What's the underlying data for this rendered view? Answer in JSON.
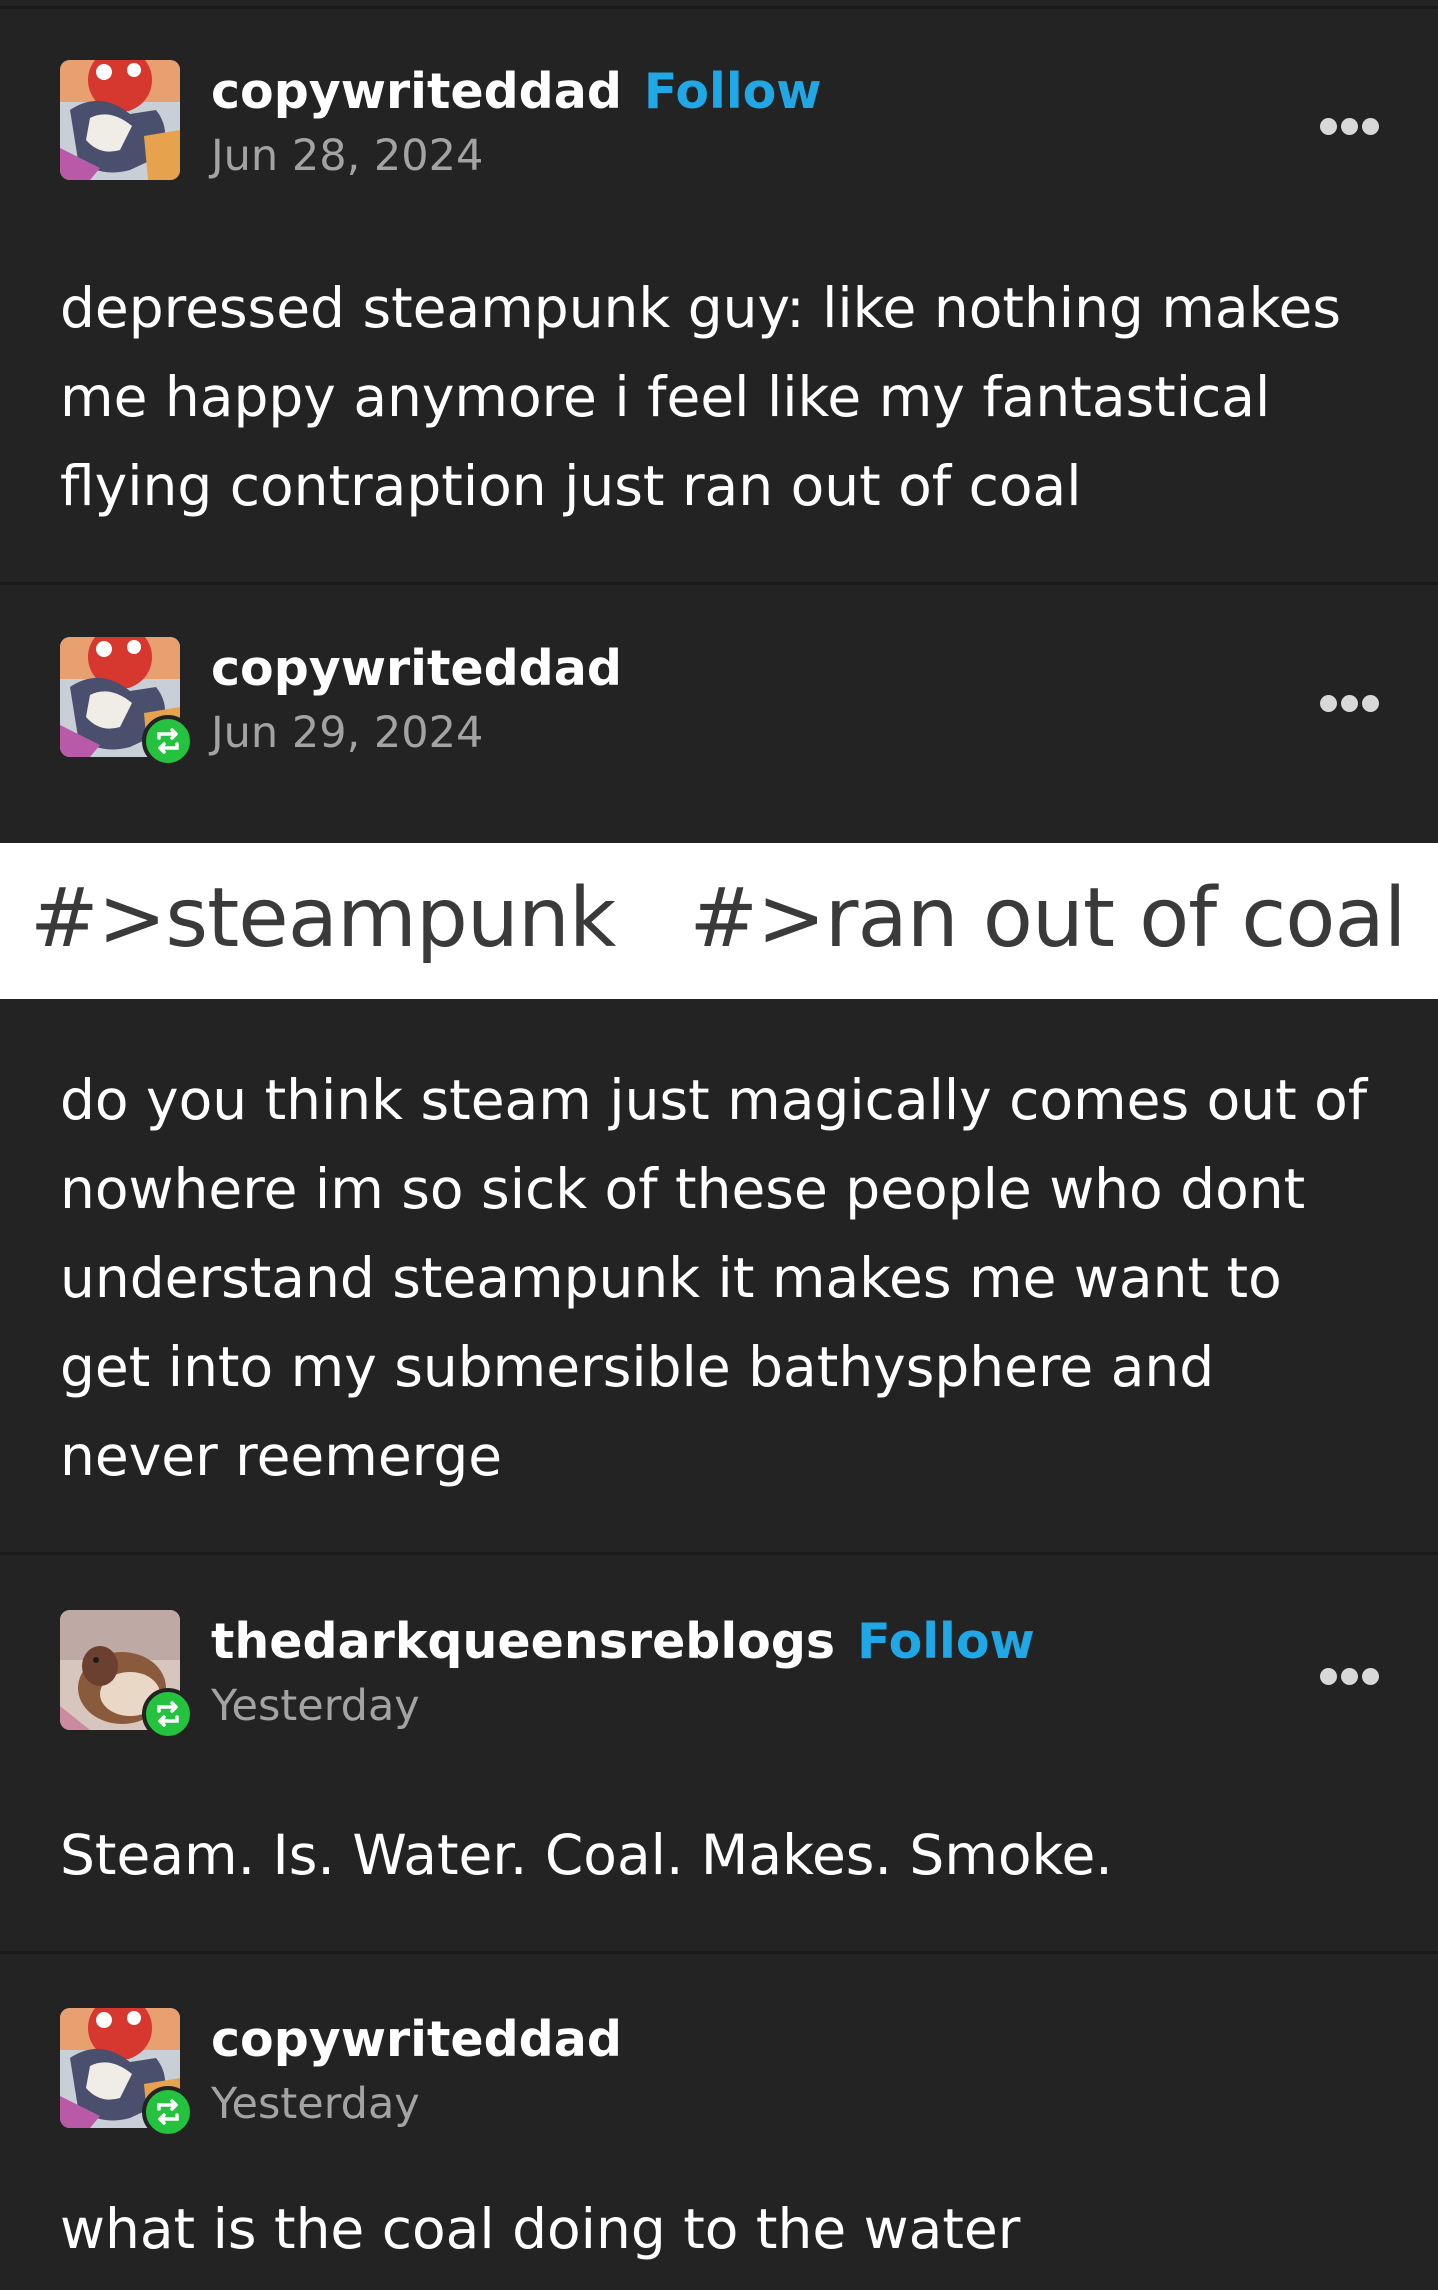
{
  "posts": [
    {
      "username": "copywriteddad",
      "follow_label": "Follow",
      "date": "Jun 28, 2024",
      "more_icon": "more-horizontal-icon",
      "text": "depressed steampunk guy: like nothing makes me happy anymore i feel like my fantastical flying contraption just ran out of coal"
    },
    {
      "username": "copywriteddad",
      "date": "Jun 29, 2024",
      "badge_icon": "reblog-icon",
      "more_icon": "more-horizontal-icon",
      "tags": [
        "#>steampunk",
        "#>ran out of coal"
      ],
      "text": "do you think steam just magically comes out of nowhere im so sick of these people who dont understand steampunk it makes me want to get into my submersible bathysphere and never reemerge"
    },
    {
      "username": "thedarkqueensreblogs",
      "follow_label": "Follow",
      "date": "Yesterday",
      "badge_icon": "reblog-icon",
      "more_icon": "more-horizontal-icon",
      "text": "Steam. Is. Water. Coal. Makes. Smoke."
    },
    {
      "username": "copywriteddad",
      "date": "Yesterday",
      "badge_icon": "reblog-icon",
      "text": "what is the coal doing to the water"
    }
  ],
  "colors": {
    "background": "#232323",
    "follow": "#1fa7e6",
    "reblog_badge": "#24c23f",
    "date": "#a3a3a3"
  }
}
